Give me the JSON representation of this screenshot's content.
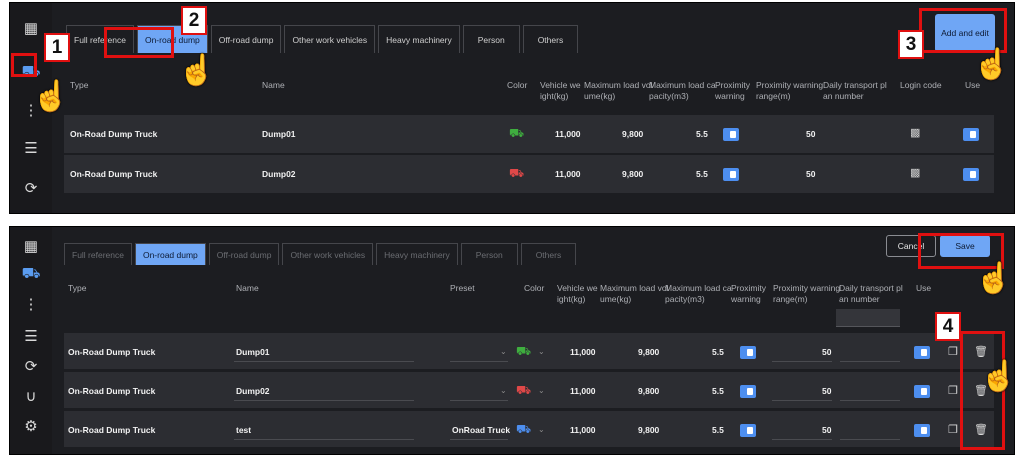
{
  "colors": {
    "accent": "#6fa6f5",
    "panel": "#1c1d21",
    "row": "#2c2d32",
    "toggle": "#4d8eef",
    "annotation": "#e01010"
  },
  "tabs": [
    "Full reference",
    "On-road dump",
    "Off-road dump",
    "Other work vehicles",
    "Heavy machinery",
    "Person",
    "Others"
  ],
  "top": {
    "headers": {
      "type": "Type",
      "name": "Name",
      "color": "Color",
      "weight": "Vehicle we\night(kg)",
      "volume": "Maximum load vol\nume(kg)",
      "capacity": "Maximum load ca\npacity(m3)",
      "prox": "Proximity\nwarning",
      "range": "Proximity warning\nrange(m)",
      "daily": "Daily transport pl\nan number",
      "login": "Login code",
      "use": "Use"
    },
    "add_label": "Add and edit",
    "rows": [
      {
        "type": "On-Road Dump Truck",
        "name": "Dump01",
        "weight": "11,000",
        "volume": "9,800",
        "capacity": "5.5",
        "range": "50",
        "truck_color": "#3fae3f"
      },
      {
        "type": "On-Road Dump Truck",
        "name": "Dump02",
        "weight": "11,000",
        "volume": "9,800",
        "capacity": "5.5",
        "range": "50",
        "truck_color": "#e04848"
      }
    ]
  },
  "bottom": {
    "headers": {
      "type": "Type",
      "name": "Name",
      "preset": "Preset",
      "color": "Color",
      "weight": "Vehicle we\night(kg)",
      "volume": "Maximum load vol\nume(kg)",
      "capacity": "Maximum load ca\npacity(m3)",
      "prox": "Proximity\nwarning",
      "range": "Proximity warning\nrange(m)",
      "daily": "Daily transport pl\nan number",
      "use": "Use"
    },
    "cancel_label": "Cancel",
    "save_label": "Save",
    "rows": [
      {
        "type": "On-Road Dump Truck",
        "name": "Dump01",
        "preset": "",
        "weight": "11,000",
        "volume": "9,800",
        "capacity": "5.5",
        "range": "50",
        "truck_color": "#3fae3f"
      },
      {
        "type": "On-Road Dump Truck",
        "name": "Dump02",
        "preset": "",
        "weight": "11,000",
        "volume": "9,800",
        "capacity": "5.5",
        "range": "50",
        "truck_color": "#e04848"
      },
      {
        "type": "On-Road Dump Truck",
        "name": "test",
        "preset": "OnRoad Truck",
        "weight": "11,000",
        "volume": "9,800",
        "capacity": "5.5",
        "range": "50",
        "truck_color": "#4d8eef"
      }
    ]
  },
  "steps": [
    "1",
    "2",
    "3",
    "4"
  ]
}
